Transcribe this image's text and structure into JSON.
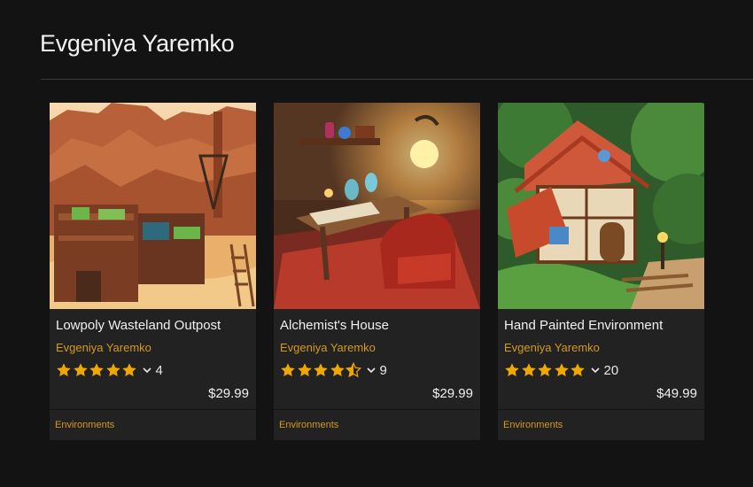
{
  "page": {
    "title": "Evgeniya Yaremko"
  },
  "colors": {
    "background": "#131313",
    "card": "#222222",
    "accent": "#d49a1c",
    "star": "#f0a800"
  },
  "products": [
    {
      "title": "Lowpoly Wasteland Outpost",
      "author": "Evgeniya Yaremko",
      "rating": 5,
      "reviews": "4",
      "price": "$29.99",
      "category": "Environments",
      "image": "wasteland-outpost-thumbnail"
    },
    {
      "title": "Alchemist's House",
      "author": "Evgeniya Yaremko",
      "rating": 4.5,
      "reviews": "9",
      "price": "$29.99",
      "category": "Environments",
      "image": "alchemist-house-thumbnail"
    },
    {
      "title": "Hand Painted Environment",
      "author": "Evgeniya Yaremko",
      "rating": 5,
      "reviews": "20",
      "price": "$49.99",
      "category": "Environments",
      "image": "hand-painted-house-thumbnail"
    }
  ]
}
